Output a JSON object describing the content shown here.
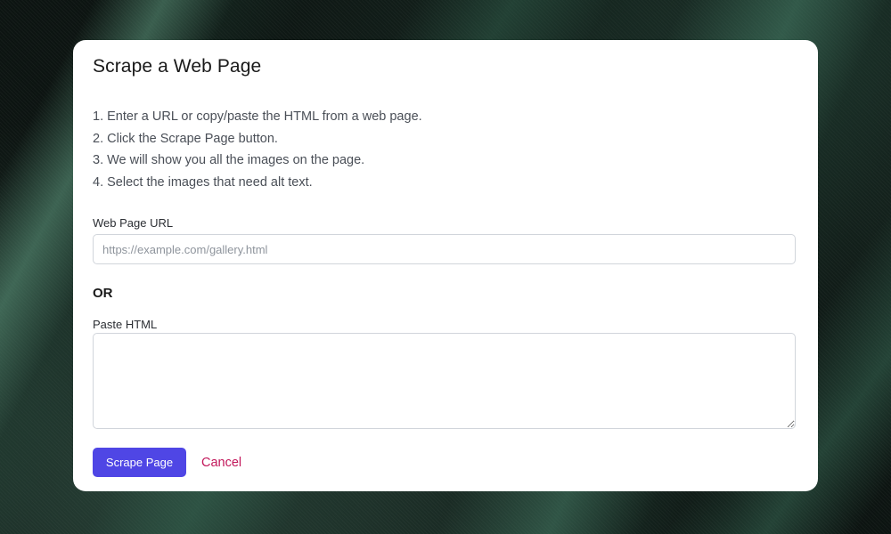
{
  "dialog": {
    "title": "Scrape a Web Page",
    "steps": [
      "1. Enter a URL or copy/paste the HTML from a web page.",
      "2. Click the Scrape Page button.",
      "3. We will show you all the images on the page.",
      "4. Select the images that need alt text."
    ],
    "url_field": {
      "label": "Web Page URL",
      "value": "",
      "placeholder": "https://example.com/gallery.html"
    },
    "or_text": "OR",
    "html_field": {
      "label": "Paste HTML",
      "value": "",
      "placeholder": ""
    },
    "buttons": {
      "scrape_label": "Scrape Page",
      "cancel_label": "Cancel"
    }
  },
  "colors": {
    "primary_button": "#4f46e5",
    "cancel_text": "#c2185b",
    "background": "#0d1512"
  }
}
